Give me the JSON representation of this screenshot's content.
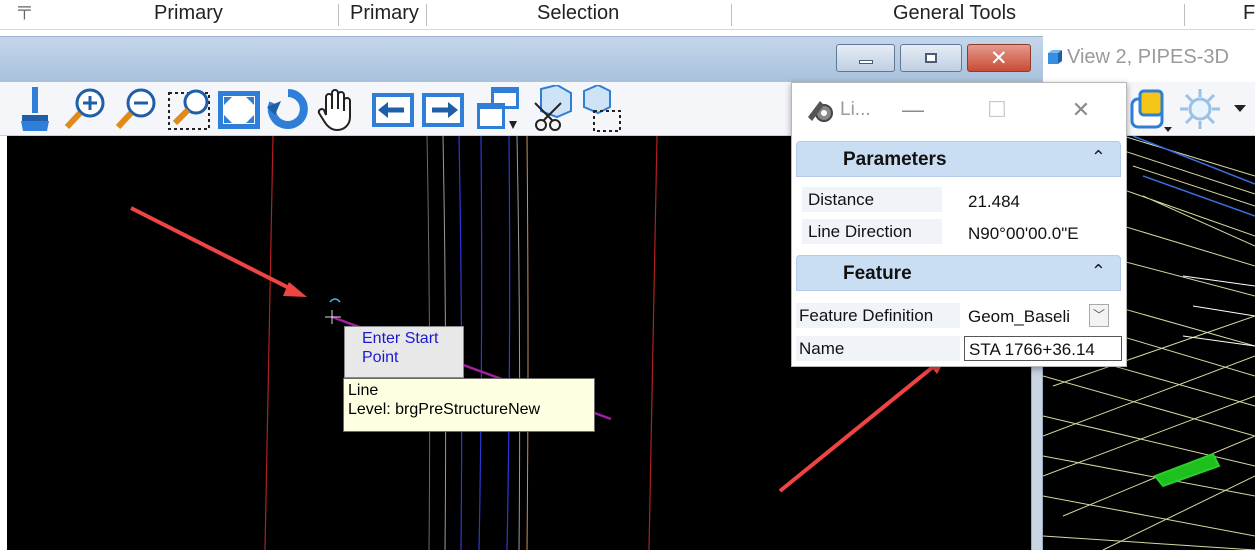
{
  "ribbon": {
    "groups": [
      "Primary",
      "Primary",
      "Selection",
      "General Tools",
      "F"
    ]
  },
  "view2": {
    "title": "View 2, PIPES-3D"
  },
  "tooltips": {
    "prompt_line1": "Enter Start",
    "prompt_line2": "Point",
    "info_line1": "Line",
    "info_line2": "Level: brgPreStructureNew"
  },
  "panel": {
    "title": "Li...",
    "min_glyph": "—",
    "max_glyph": "☐",
    "close_glyph": "✕",
    "parameters": {
      "label": "Parameters",
      "caret": "⌃",
      "distance_label": "Distance",
      "distance_value": "21.484",
      "direction_label": "Line Direction",
      "direction_value": "N90°00'00.0\"E"
    },
    "feature": {
      "label": "Feature",
      "caret": "⌃",
      "definition_label": "Feature Definition",
      "definition_value": "Geom_Baseli",
      "name_label": "Name",
      "name_value": "STA 1766+36.14"
    }
  },
  "colors": {
    "annotation_arrow": "#ef4444",
    "accent": "#2f7fd8",
    "canvas": "#000000",
    "drawn_line": "#a020a0"
  },
  "icons": [
    "pin-icon",
    "brush-icon",
    "zoom-in-icon",
    "zoom-out-icon",
    "window-area-icon",
    "fit-view-icon",
    "rotate-view-icon",
    "pan-hand-icon",
    "previous-view-icon",
    "next-view-icon",
    "copy-view-icon",
    "clip-volume-icon",
    "clip-mask-icon",
    "view-display-mode-icon",
    "lighting-icon",
    "more-tools-icon"
  ]
}
